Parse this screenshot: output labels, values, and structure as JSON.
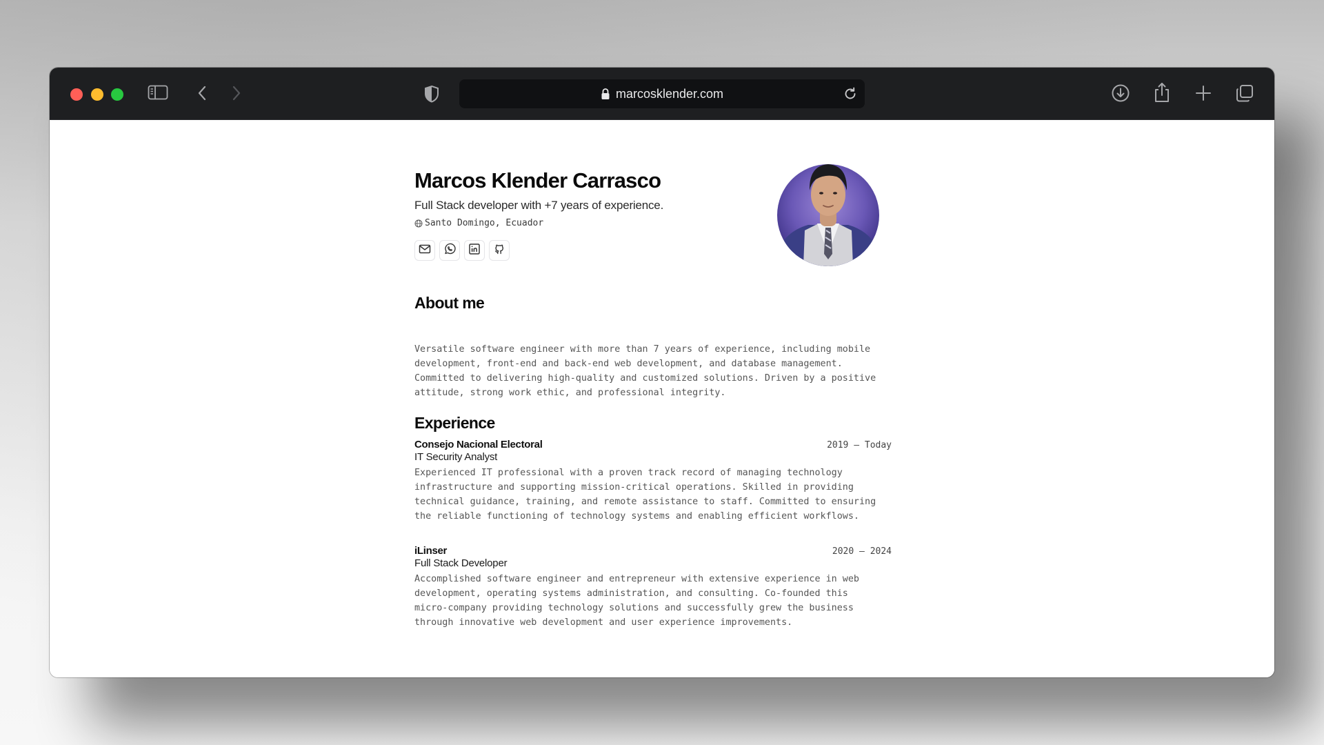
{
  "browser": {
    "url": "marcosklender.com"
  },
  "profile": {
    "name": "Marcos Klender Carrasco",
    "tagline": "Full Stack developer with +7 years of experience.",
    "location": "Santo Domingo, Ecuador",
    "socials": [
      "mail-icon",
      "whatsapp-icon",
      "linkedin-icon",
      "github-icon"
    ]
  },
  "about": {
    "title": "About me",
    "lines": [
      "Versatile software engineer with more than 7 years of experience, including mobile",
      "development, front-end and back-end web development, and database management.",
      "Committed to delivering high-quality and customized solutions. Driven by a positive",
      "attitude, strong work ethic, and professional integrity."
    ]
  },
  "experience": {
    "title": "Experience",
    "jobs": [
      {
        "company": "Consejo Nacional Electoral",
        "role": "IT Security Analyst",
        "dates": "2019 – Today",
        "lines": [
          "Experienced IT professional with a proven track record of managing technology",
          "infrastructure and supporting mission-critical operations. Skilled in providing",
          "technical guidance, training, and remote assistance to staff. Committed to ensuring",
          "the reliable functioning of technology systems and enabling efficient workflows."
        ]
      },
      {
        "company": "iLinser",
        "role": "Full Stack Developer",
        "dates": "2020 – 2024",
        "lines": [
          "Accomplished software engineer and entrepreneur with extensive experience in web",
          "development, operating systems administration, and consulting. Co-founded this",
          "micro-company providing technology solutions and successfully grew the business",
          "through innovative web development and user experience improvements."
        ]
      }
    ]
  }
}
